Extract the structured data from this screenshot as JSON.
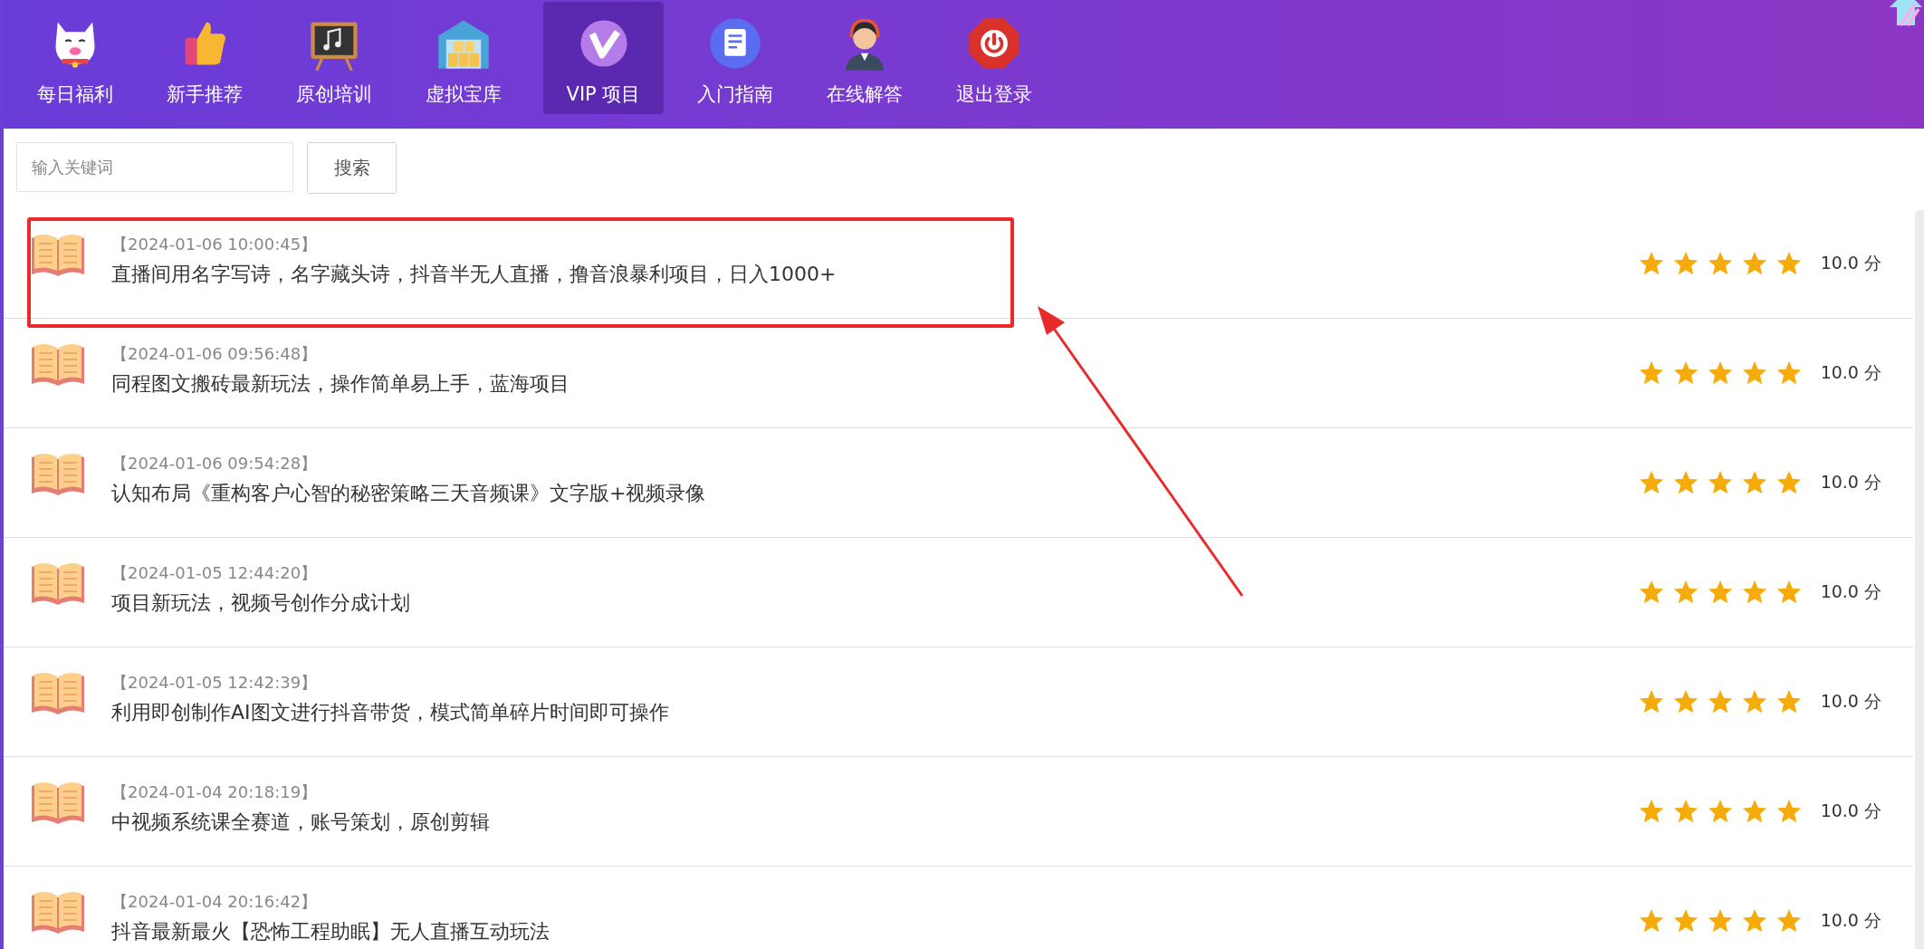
{
  "nav": {
    "items": [
      {
        "kind": "cat",
        "label": "每日福利",
        "selected": false
      },
      {
        "kind": "thumb",
        "label": "新手推荐",
        "selected": false
      },
      {
        "kind": "board",
        "label": "原创培训",
        "selected": false
      },
      {
        "kind": "warehouse",
        "label": "虚拟宝库",
        "selected": false
      },
      {
        "kind": "vip",
        "label": "VIP 项目",
        "selected": true
      },
      {
        "kind": "doc",
        "label": "入门指南",
        "selected": false
      },
      {
        "kind": "agent",
        "label": "在线解答",
        "selected": false
      },
      {
        "kind": "power",
        "label": "退出登录",
        "selected": false
      }
    ]
  },
  "search": {
    "placeholder": "输入关键词",
    "button": "搜索"
  },
  "rows": [
    {
      "date": "【2024-01-06 10:00:45】",
      "title": "直播间用名字写诗，名字藏头诗，抖音半无人直播，撸音浪暴利项目，日入1000+",
      "stars": 5,
      "score": "10.0 分",
      "highlighted": true
    },
    {
      "date": "【2024-01-06 09:56:48】",
      "title": "同程图文搬砖最新玩法，操作简单易上手，蓝海项目",
      "stars": 5,
      "score": "10.0 分",
      "highlighted": false
    },
    {
      "date": "【2024-01-06 09:54:28】",
      "title": "认知布局《重构客户心智的秘密策略三天音频课》文字版+视频录像",
      "stars": 5,
      "score": "10.0 分",
      "highlighted": false
    },
    {
      "date": "【2024-01-05 12:44:20】",
      "title": "项目新玩法，视频号创作分成计划",
      "stars": 5,
      "score": "10.0 分",
      "highlighted": false
    },
    {
      "date": "【2024-01-05 12:42:39】",
      "title": "利用即创制作AI图文进行抖音带货，模式简单碎片时间即可操作",
      "stars": 5,
      "score": "10.0 分",
      "highlighted": false
    },
    {
      "date": "【2024-01-04 20:18:19】",
      "title": "中视频系统课全赛道，账号策划，原创剪辑",
      "stars": 5,
      "score": "10.0 分",
      "highlighted": false
    },
    {
      "date": "【2024-01-04 20:16:42】",
      "title": "抖音最新最火【恐怖工程助眠】无人直播互动玩法",
      "stars": 5,
      "score": "10.0 分",
      "highlighted": false
    }
  ]
}
